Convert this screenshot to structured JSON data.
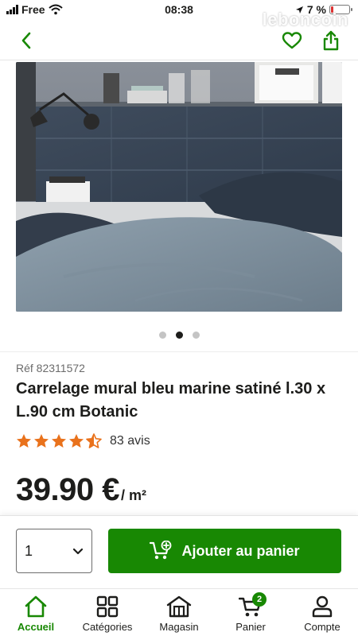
{
  "status_bar": {
    "carrier": "Free",
    "time": "08:38",
    "battery_percent": "7 %",
    "watermark": "leboncoin"
  },
  "product": {
    "reference": "Réf 82311572",
    "title": "Carrelage mural bleu marine satiné l.30 x L.90 cm Botanic",
    "rating_value": 4.5,
    "reviews": "83 avis",
    "price": "39.90 €",
    "price_unit": "/ m²"
  },
  "carousel": {
    "count": 3,
    "active_index": 1
  },
  "cart": {
    "quantity": "1",
    "add_label": "Ajouter au panier"
  },
  "tabbar": {
    "items": [
      {
        "label": "Accueil"
      },
      {
        "label": "Catégories"
      },
      {
        "label": "Magasin"
      },
      {
        "label": "Panier",
        "badge": "2"
      },
      {
        "label": "Compte"
      }
    ]
  },
  "colors": {
    "brand_green": "#188803",
    "star_orange": "#e9721c"
  }
}
